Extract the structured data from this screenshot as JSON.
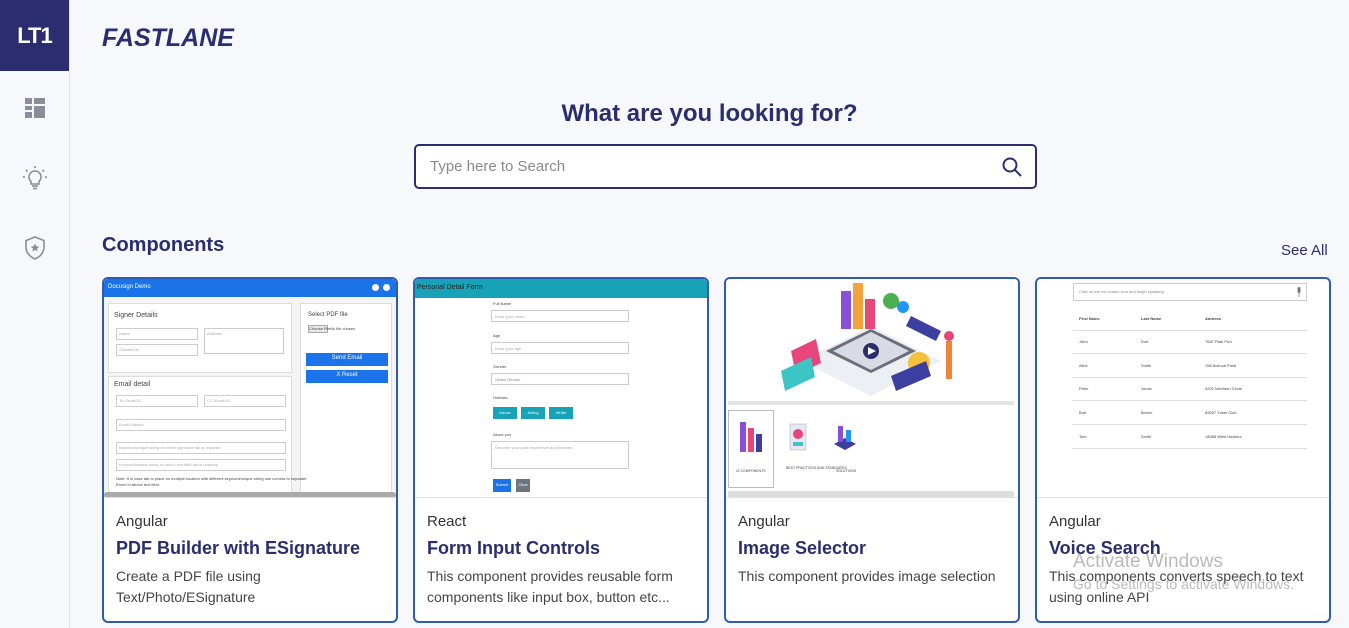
{
  "sidebar": {
    "logo": "LT1",
    "items": [
      {
        "icon": "dashboard-icon"
      },
      {
        "icon": "lightbulb-icon"
      },
      {
        "icon": "shield-star-icon"
      }
    ]
  },
  "header": {
    "brand": "FASTLANE"
  },
  "hero": {
    "headline": "What are you looking for?",
    "search_placeholder": "Type here to Search",
    "search_icon": "search-icon"
  },
  "components": {
    "title": "Components",
    "see_all": "See All",
    "cards": [
      {
        "framework": "Angular",
        "title": "PDF Builder with ESignature",
        "description": "Create a PDF file using Text/Photo/ESignature",
        "preview": {
          "header": "Docusign Demo",
          "signer_section": "Signer Details",
          "name_ph": "Name",
          "address_ph": "Address",
          "contact_ph": "Contact No",
          "pdf_label": "Select PDF file",
          "choose_file": "Choose File",
          "no_file": "No file chosen",
          "send_email": "Send Email",
          "reset": "X Reset",
          "email_section": "Email detail",
          "to_ph": "To: Email ID",
          "cc_ph": "CC: Email ID",
          "subject_ph": "Email Subject",
          "kw1": "Keyword/Unique string on which signature tab is required",
          "kw2": "Keyword/unique string on which text field tab is required",
          "note": "Note: If in case tab to place on multiple location with different keyword/unique string use comma to separate",
          "note2": "Enum in above text field."
        }
      },
      {
        "framework": "React",
        "title": "Form Input Controls",
        "description": "This component provides reusable form components like input box, button etc...",
        "preview": {
          "header": "Personal Detail Form",
          "full_name": "Full Name",
          "full_name_ph": "Enter your name",
          "age": "Age",
          "age_ph": "Enter your age",
          "gender": "Gender",
          "gender_ph": "Select Gender",
          "hobbies": "Hobbies",
          "h1": "Dance",
          "h2": "Acting",
          "h3": "Writer",
          "about": "About you",
          "about_ph": "Describe your past experience and hobbies",
          "submit": "Submit",
          "clear": "Clear"
        }
      },
      {
        "framework": "Angular",
        "title": "Image Selector",
        "description": "This component provides image selection",
        "preview": {
          "t1": "UI COMPONENTS",
          "t2": "BEST PRACTICES AND STANDARDS",
          "t3": "SOLUTIONS"
        }
      },
      {
        "framework": "Angular",
        "title": "Voice Search",
        "description": "This components converts speech to text using online API",
        "preview": {
          "search_ph": "Click on the mic button icon and begin speaking",
          "columns": [
            "First Name",
            "Last Name",
            "Address"
          ],
          "rows": [
            [
              "John",
              "Doe",
              "7687 Park Port"
            ],
            [
              "Alice",
              "Smith",
              "156 Avenue Point"
            ],
            [
              "Peter",
              "Jones",
              "5202 Northern Circle"
            ],
            [
              "Bob",
              "Brown",
              "89097 Yoker Club"
            ],
            [
              "Tom",
              "Smith",
              "18088 West Harbour"
            ]
          ]
        }
      }
    ]
  },
  "watermark": {
    "line1": "Activate Windows",
    "line2": "Go to Settings to activate Windows."
  },
  "colors": {
    "navy": "#2b2d6e",
    "card_border": "#2f5bb0",
    "background": "#f7f8fc",
    "docusign_blue": "#1a73e8",
    "form_teal": "#17a2b8"
  }
}
